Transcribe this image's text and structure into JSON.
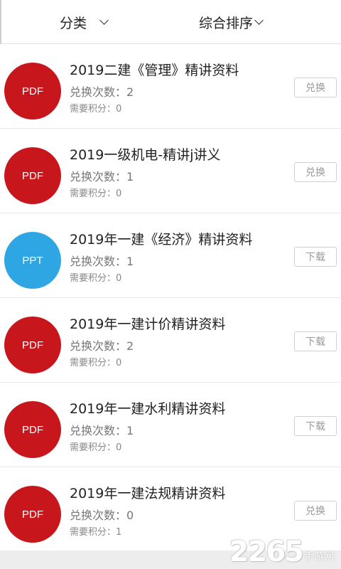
{
  "filter": {
    "category_label": "分类",
    "sort_label": "综合排序"
  },
  "items": [
    {
      "badge": "PDF",
      "badge_color": "#c8161d",
      "title": "2019二建《管理》精讲资料",
      "count": "兑换次数：2",
      "points": "需要积分：0",
      "action": "兑换"
    },
    {
      "badge": "PDF",
      "badge_color": "#c8161d",
      "title": "2019一级机电-精讲j讲义",
      "count": "兑换次数：1",
      "points": "需要积分：0",
      "action": "兑换"
    },
    {
      "badge": "PPT",
      "badge_color": "#2fa6e4",
      "title": "2019年一建《经济》精讲资料",
      "count": "兑换次数：1",
      "points": "需要积分：0",
      "action": "下载"
    },
    {
      "badge": "PDF",
      "badge_color": "#c8161d",
      "title": "2019年一建计价精讲资料",
      "count": "兑换次数：2",
      "points": "需要积分：0",
      "action": "下载"
    },
    {
      "badge": "PDF",
      "badge_color": "#c8161d",
      "title": "2019年一建水利精讲资料",
      "count": "兑换次数：1",
      "points": "需要积分：0",
      "action": "下载"
    },
    {
      "badge": "PDF",
      "badge_color": "#c8161d",
      "title": "2019年一建法规精讲资料",
      "count": "兑换次数：0",
      "points": "需要积分：1",
      "action": "兑换"
    }
  ],
  "watermark": {
    "number": "2265",
    "site": "手游网"
  }
}
